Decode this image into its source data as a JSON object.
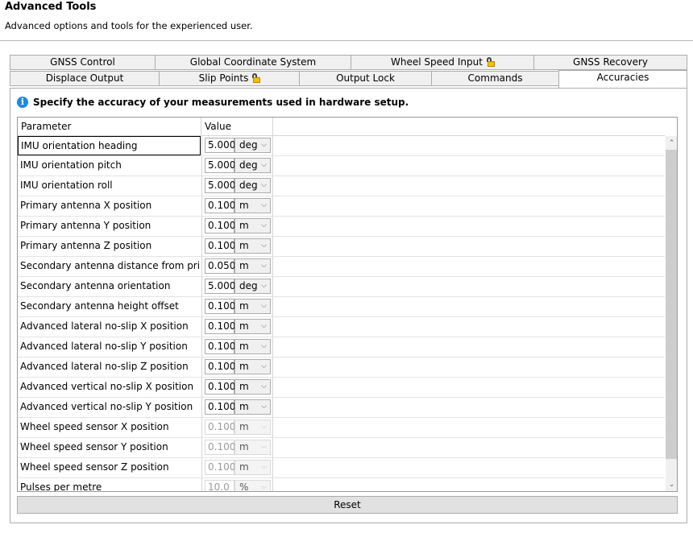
{
  "header": {
    "title": "Advanced Tools",
    "subtitle": "Advanced options and tools for the experienced user."
  },
  "tabs": {
    "row1": [
      {
        "label": "GNSS Control",
        "locked": false
      },
      {
        "label": "Global Coordinate System",
        "locked": false
      },
      {
        "label": "Wheel Speed Input",
        "locked": true
      },
      {
        "label": "GNSS Recovery",
        "locked": false
      }
    ],
    "row2": [
      {
        "label": "Displace Output",
        "locked": false
      },
      {
        "label": "Slip Points",
        "locked": true
      },
      {
        "label": "Output Lock",
        "locked": false
      },
      {
        "label": "Commands",
        "locked": false
      },
      {
        "label": "Accuracies",
        "locked": false,
        "active": true
      }
    ]
  },
  "info": {
    "icon": "info-icon",
    "text": "Specify the accuracy of your measurements used in hardware setup."
  },
  "grid": {
    "columns": [
      "Parameter",
      "Value"
    ],
    "rows": [
      {
        "name": "IMU orientation heading",
        "value": "5.000",
        "unit": "deg",
        "enabled": true
      },
      {
        "name": "IMU orientation pitch",
        "value": "5.000",
        "unit": "deg",
        "enabled": true
      },
      {
        "name": "IMU orientation roll",
        "value": "5.000",
        "unit": "deg",
        "enabled": true
      },
      {
        "name": "Primary antenna X position",
        "value": "0.100",
        "unit": "m",
        "enabled": true
      },
      {
        "name": "Primary antenna Y position",
        "value": "0.100",
        "unit": "m",
        "enabled": true
      },
      {
        "name": "Primary antenna Z position",
        "value": "0.100",
        "unit": "m",
        "enabled": true
      },
      {
        "name": "Secondary antenna distance from primary",
        "value": "0.050",
        "unit": "m",
        "enabled": true
      },
      {
        "name": "Secondary antenna orientation",
        "value": "5.000",
        "unit": "deg",
        "enabled": true
      },
      {
        "name": "Secondary antenna height offset",
        "value": "0.100",
        "unit": "m",
        "enabled": true
      },
      {
        "name": "Advanced lateral no-slip X position",
        "value": "0.100",
        "unit": "m",
        "enabled": true
      },
      {
        "name": "Advanced lateral no-slip Y position",
        "value": "0.100",
        "unit": "m",
        "enabled": true
      },
      {
        "name": "Advanced lateral no-slip Z position",
        "value": "0.100",
        "unit": "m",
        "enabled": true
      },
      {
        "name": "Advanced vertical no-slip X position",
        "value": "0.100",
        "unit": "m",
        "enabled": true
      },
      {
        "name": "Advanced vertical no-slip Y position",
        "value": "0.100",
        "unit": "m",
        "enabled": true
      },
      {
        "name": "Wheel speed sensor X position",
        "value": "0.100",
        "unit": "m",
        "enabled": false
      },
      {
        "name": "Wheel speed sensor Y position",
        "value": "0.100",
        "unit": "m",
        "enabled": false
      },
      {
        "name": "Wheel speed sensor Z position",
        "value": "0.100",
        "unit": "m",
        "enabled": false
      },
      {
        "name": "Pulses per metre",
        "value": "10.0",
        "unit": "%",
        "enabled": false
      }
    ]
  },
  "reset_label": "Reset"
}
